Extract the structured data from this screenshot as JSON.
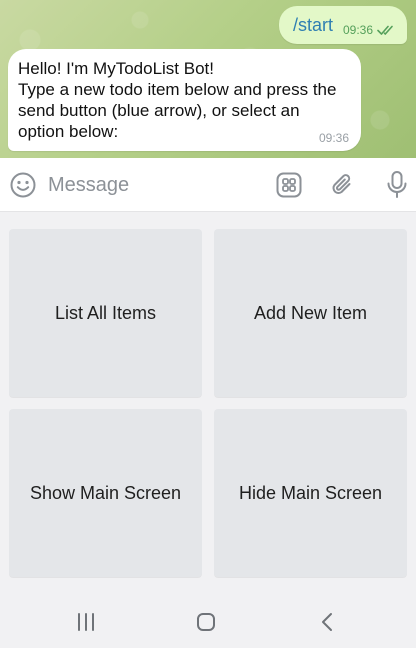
{
  "chat": {
    "outgoing": {
      "text": "/start",
      "time": "09:36",
      "status_icon": "double-check-icon",
      "bubble_color": "#e3f8c8",
      "text_color": "#2f7fb2",
      "time_color": "#55a05b"
    },
    "incoming": {
      "text": "Hello! I'm MyTodoList Bot!\nType a new todo item below and press the send button (blue arrow), or select an option below:",
      "time": "09:36"
    }
  },
  "input_bar": {
    "placeholder": "Message",
    "icons": [
      "smile-icon",
      "keyboard-icon",
      "paperclip-icon",
      "microphone-icon"
    ]
  },
  "keyboard": {
    "buttons": [
      {
        "label": "List All Items"
      },
      {
        "label": "Add New Item"
      },
      {
        "label": "Show Main Screen"
      },
      {
        "label": "Hide Main Screen"
      }
    ]
  },
  "nav_bar": {
    "icons": [
      "recent-apps-icon",
      "home-icon",
      "back-icon"
    ]
  }
}
